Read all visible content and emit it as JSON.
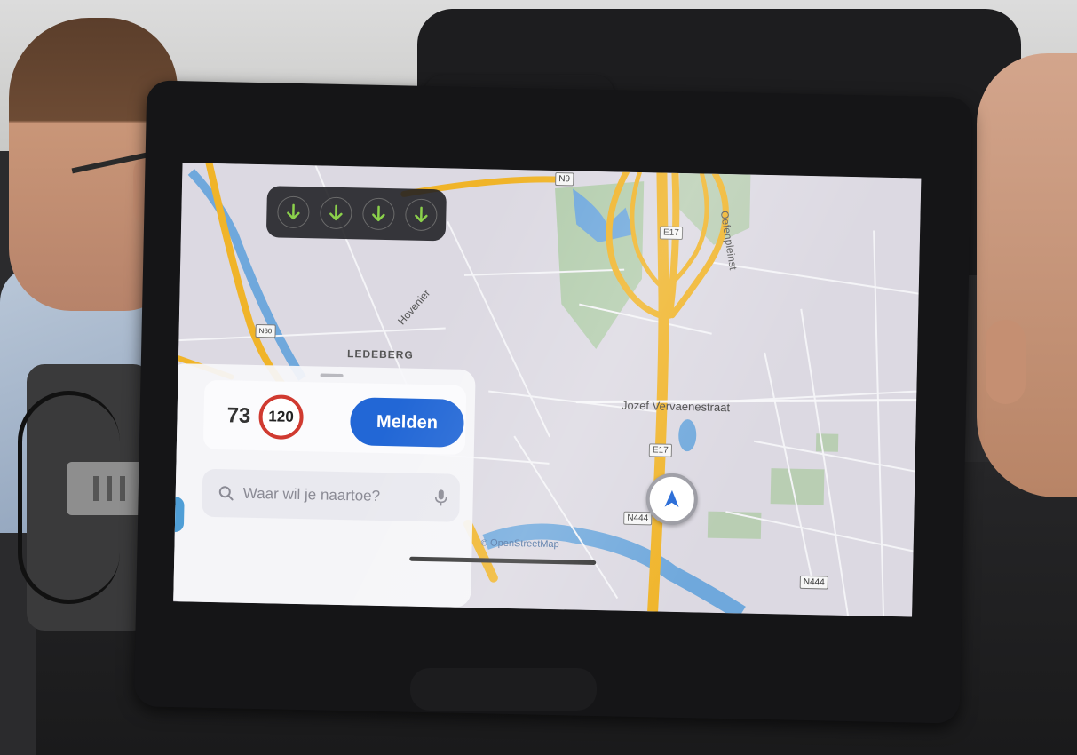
{
  "lane_guidance": {
    "lanes": [
      "arrow-down-icon",
      "arrow-down-icon",
      "arrow-down-icon",
      "arrow-down-icon"
    ],
    "arrow_color": "#8bd14b"
  },
  "map": {
    "labels": {
      "district": "LEDEBERG",
      "street_main": "Jozef Vervaenestraat",
      "street_right": "Oefenpleinst",
      "street_left": "Hovenier"
    },
    "road_shields": {
      "n_top": "N9",
      "e17_top": "E17",
      "e17_mid": "E17",
      "n444_left": "N444",
      "n444_right": "N444",
      "n_small": "N60"
    },
    "attribution": "OpenStreetMap",
    "attribution_symbol": "©",
    "colors": {
      "highway": "#f0b429",
      "water": "#6fa8dc",
      "park": "#9bc48f",
      "background": "#dcd9e2"
    }
  },
  "panel": {
    "current_speed": "73",
    "speed_limit": "120",
    "report_button": "Melden",
    "search_placeholder": "Waar wil je naartoe?"
  },
  "accent": "#2267d6",
  "limit_color": "#d03a30"
}
